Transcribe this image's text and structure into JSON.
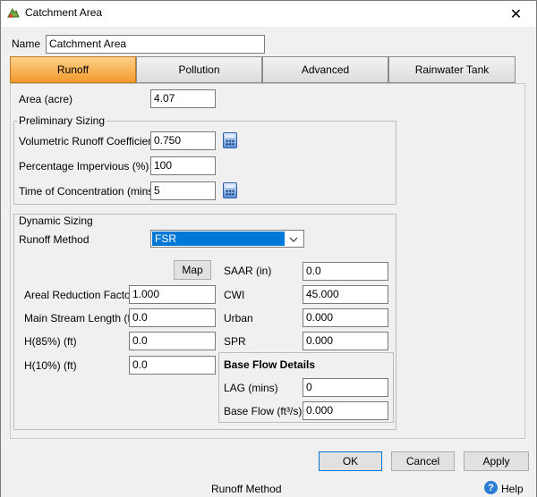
{
  "window": {
    "title": "Catchment Area",
    "close_glyph": "✕"
  },
  "name": {
    "label": "Name",
    "value": "Catchment Area"
  },
  "tabs": [
    {
      "label": "Runoff",
      "active": true
    },
    {
      "label": "Pollution",
      "active": false
    },
    {
      "label": "Advanced",
      "active": false
    },
    {
      "label": "Rainwater Tank",
      "active": false
    }
  ],
  "runoff": {
    "area": {
      "label": "Area (acre)",
      "value": "4.07"
    },
    "preliminary": {
      "title": "Preliminary Sizing",
      "runoff_coeff": {
        "label": "Volumetric Runoff Coefficient",
        "value": "0.750"
      },
      "impervious": {
        "label": "Percentage Impervious (%)",
        "value": "100"
      },
      "toc": {
        "label": "Time of Concentration (mins)",
        "value": "5"
      }
    },
    "dynamic": {
      "title": "Dynamic Sizing",
      "method": {
        "label": "Runoff Method",
        "value": "FSR"
      },
      "map_button": "Map",
      "arf": {
        "label": "Areal Reduction Factor",
        "value": "1.000"
      },
      "msl": {
        "label": "Main Stream Length (ft)",
        "value": "0.0"
      },
      "h85": {
        "label": "H(85%) (ft)",
        "value": "0.0"
      },
      "h10": {
        "label": "H(10%) (ft)",
        "value": "0.0"
      },
      "saar": {
        "label": "SAAR (in)",
        "value": "0.0"
      },
      "cwi": {
        "label": "CWI",
        "value": "45.000"
      },
      "urban": {
        "label": "Urban",
        "value": "0.000"
      },
      "spr": {
        "label": "SPR",
        "value": "0.000"
      },
      "baseflow": {
        "title": "Base Flow Details",
        "lag": {
          "label": "LAG (mins)",
          "value": "0"
        },
        "flow": {
          "label": "Base Flow (ft³/s)",
          "value": "0.000"
        }
      }
    }
  },
  "buttons": {
    "ok": "OK",
    "cancel": "Cancel",
    "apply": "Apply"
  },
  "status": {
    "text": "Runoff Method",
    "help": "Help",
    "help_glyph": "?"
  },
  "colors": {
    "active_tab": "#f29a2b",
    "selection": "#0078d7"
  }
}
